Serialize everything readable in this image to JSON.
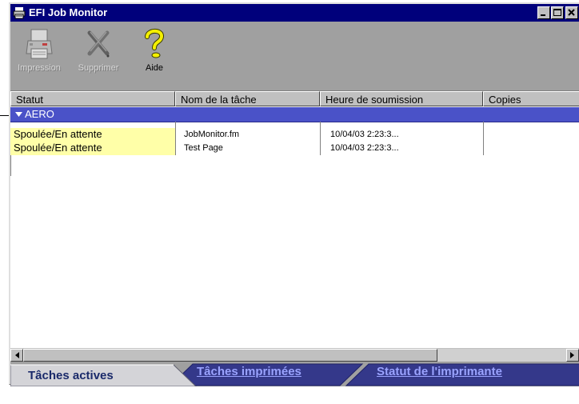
{
  "window": {
    "title": "EFI Job Monitor",
    "icon": "printer-icon",
    "controls": [
      "minimize-icon",
      "maximize-icon",
      "close-icon"
    ]
  },
  "toolbar": {
    "buttons": [
      {
        "label": "Impression",
        "icon": "printer-icon",
        "enabled": false
      },
      {
        "label": "Supprimer",
        "icon": "delete-x-icon",
        "enabled": false
      },
      {
        "label": "Aide",
        "icon": "help-question-icon",
        "enabled": true
      }
    ]
  },
  "table": {
    "columns": [
      "Statut",
      "Nom de la tâche",
      "Heure de soumission",
      "Copies"
    ],
    "group": {
      "label": "AERO",
      "expanded": true
    },
    "rows": [
      {
        "status": "Spoulée/En attente",
        "name": "JobMonitor.fm",
        "time": "10/04/03  2:23:3...",
        "copies": ""
      },
      {
        "status": "Spoulée/En attente",
        "name": "Test Page",
        "time": "10/04/03  2:23:3...",
        "copies": ""
      }
    ]
  },
  "tabs": [
    {
      "label": "Tâches actives",
      "active": true
    },
    {
      "label": "Tâches imprimées",
      "active": false
    },
    {
      "label": "Statut de l'imprimante",
      "active": false
    }
  ],
  "colors": {
    "titlebar": "#00007b",
    "group_row": "#4a52c8",
    "status_highlight": "#ffffa8",
    "inactive_tab_text": "#9aa3ff"
  }
}
